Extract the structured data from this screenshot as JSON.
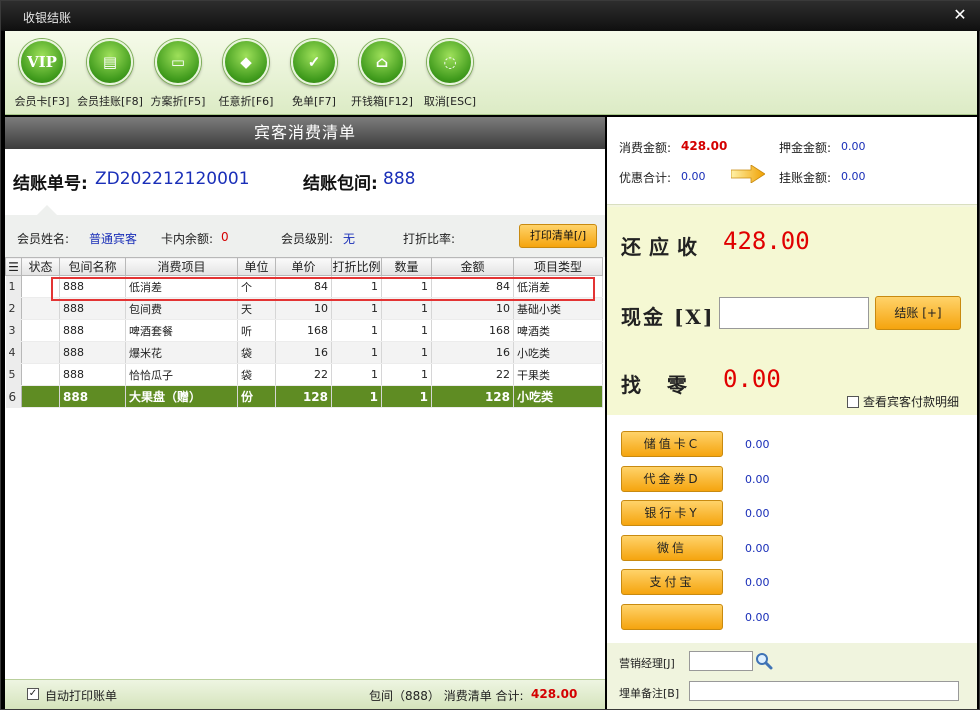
{
  "window": {
    "title": "收银结账",
    "close": "✕"
  },
  "toolbar": [
    {
      "icon": "vip-icon",
      "glyph": "VIP",
      "label": "会员卡[F3]"
    },
    {
      "icon": "member-credit-icon",
      "glyph": "▤",
      "label": "会员挂账[F8]"
    },
    {
      "icon": "scheme-discount-icon",
      "glyph": "▭",
      "label": "方案折[F5]"
    },
    {
      "icon": "any-discount-icon",
      "glyph": "◆",
      "label": "任意折[F6]"
    },
    {
      "icon": "free-bill-icon",
      "glyph": "✓",
      "label": "免单[F7]"
    },
    {
      "icon": "cash-drawer-icon",
      "glyph": "⌂",
      "label": "开钱箱[F12]"
    },
    {
      "icon": "cancel-icon",
      "glyph": "◌",
      "label": "取消[ESC]"
    }
  ],
  "list": {
    "header": "宾客消费清单",
    "bill_no_label": "结账单号:",
    "bill_no": "ZD202212120001",
    "room_label": "结账包间:",
    "room": "888",
    "member_name_label": "会员姓名:",
    "member_name": "普通宾客",
    "card_balance_label": "卡内余额:",
    "card_balance": "0",
    "member_level_label": "会员级别:",
    "member_level": "无",
    "discount_label": "打折比率:",
    "print_button": "打印清单[/]",
    "columns": [
      "☰",
      "状态",
      "包间名称",
      "消费项目",
      "单位",
      "单价",
      "打折比例",
      "数量",
      "金额",
      "项目类型"
    ],
    "rows": [
      {
        "idx": "1",
        "status": "",
        "room": "888",
        "item": "低消差",
        "unit": "个",
        "price": "84",
        "discount": "1",
        "qty": "1",
        "amount": "84",
        "type": "低消差"
      },
      {
        "idx": "2",
        "status": "",
        "room": "888",
        "item": "包间费",
        "unit": "天",
        "price": "10",
        "discount": "1",
        "qty": "1",
        "amount": "10",
        "type": "基础小类"
      },
      {
        "idx": "3",
        "status": "",
        "room": "888",
        "item": "啤酒套餐",
        "unit": "听",
        "price": "168",
        "discount": "1",
        "qty": "1",
        "amount": "168",
        "type": "啤酒类"
      },
      {
        "idx": "4",
        "status": "",
        "room": "888",
        "item": "爆米花",
        "unit": "袋",
        "price": "16",
        "discount": "1",
        "qty": "1",
        "amount": "16",
        "type": "小吃类"
      },
      {
        "idx": "5",
        "status": "",
        "room": "888",
        "item": "恰恰瓜子",
        "unit": "袋",
        "price": "22",
        "discount": "1",
        "qty": "1",
        "amount": "22",
        "type": "干果类"
      },
      {
        "idx": "6",
        "status": "",
        "room": "888",
        "item": "大果盘（赠）",
        "unit": "份",
        "price": "128",
        "discount": "1",
        "qty": "1",
        "amount": "128",
        "type": "小吃类"
      }
    ],
    "auto_print_label": "自动打印账单",
    "auto_print_checked": "✓",
    "footer_text": "包间（888） 消费清单 合计:",
    "footer_total": "428.00"
  },
  "summary": {
    "consume_label": "消费金额:",
    "consume": "428.00",
    "deposit_label": "押金金额:",
    "deposit": "0.00",
    "discount_total_label": "优惠合计:",
    "discount_total": "0.00",
    "credit_label": "挂账金额:",
    "credit": "0.00"
  },
  "due": {
    "receivable_label": "还应收",
    "receivable": "428.00",
    "cash_label": "现金 [X]",
    "cash_value": "",
    "settle_button": "结账 [+]",
    "change_label": "找  零",
    "change": "0.00",
    "detail_label": "查看宾客付款明细"
  },
  "payments": [
    {
      "label": "储值卡C",
      "value": "0.00"
    },
    {
      "label": "代金券D",
      "value": "0.00"
    },
    {
      "label": "银行卡Y",
      "value": "0.00"
    },
    {
      "label": "微信",
      "value": "0.00"
    },
    {
      "label": "支付宝",
      "value": "0.00"
    },
    {
      "label": "",
      "value": "0.00"
    }
  ],
  "bottom": {
    "manager_label": "营销经理[J]",
    "remark_label": "埋单备注[B]"
  },
  "colors": {
    "accent_green": "#5f8c23",
    "amount_red": "#e00000",
    "value_blue": "#1a2fb8",
    "button_orange": "#f5a40e",
    "highlight_box": "#e33434"
  }
}
